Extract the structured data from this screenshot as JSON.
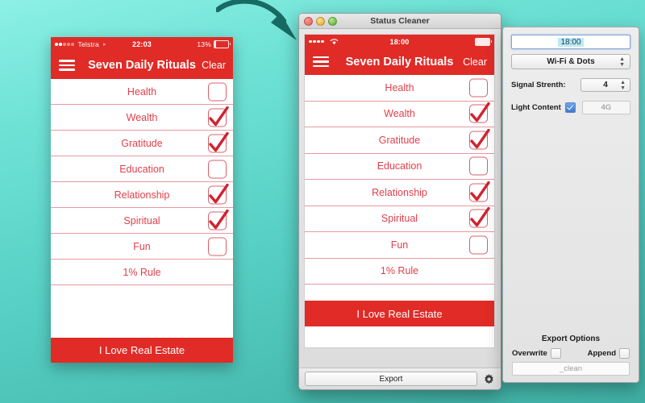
{
  "phone": {
    "statusbar": {
      "carrier": "Telstra",
      "time": "22:03",
      "battery_pct": "13%",
      "battery_level": 13,
      "signal_dots_filled": 2,
      "signal_dots_total": 5,
      "caret": "▸"
    },
    "navbar": {
      "title": "Seven Daily Rituals",
      "clear_label": "Clear",
      "menu_icon": "hamburger-icon"
    },
    "rows": [
      {
        "label": "Health",
        "checkbox": true,
        "checked": false
      },
      {
        "label": "Wealth",
        "checkbox": true,
        "checked": true
      },
      {
        "label": "Gratitude",
        "checkbox": true,
        "checked": true
      },
      {
        "label": "Education",
        "checkbox": true,
        "checked": false
      },
      {
        "label": "Relationship",
        "checkbox": true,
        "checked": true
      },
      {
        "label": "Spiritual",
        "checkbox": true,
        "checked": true
      },
      {
        "label": "Fun",
        "checkbox": true,
        "checked": false
      },
      {
        "label": "1% Rule",
        "checkbox": false,
        "checked": false
      }
    ],
    "footer_label": "I Love Real Estate"
  },
  "mac_window": {
    "title": "Status Cleaner",
    "traffic_lights": [
      "close-button",
      "minimize-button",
      "zoom-button"
    ],
    "export_button_label": "Export",
    "gear_icon": "gear-icon",
    "preview": {
      "statusbar": {
        "time": "18:00",
        "signal_dots_filled": 4,
        "signal_dots_total": 4,
        "wifi_icon": "wifi-icon",
        "battery_full": true
      },
      "navbar": {
        "title": "Seven Daily Rituals",
        "clear_label": "Clear",
        "menu_icon": "hamburger-icon"
      },
      "rows": [
        {
          "label": "Health",
          "checkbox": true,
          "checked": false
        },
        {
          "label": "Wealth",
          "checkbox": true,
          "checked": true
        },
        {
          "label": "Gratitude",
          "checkbox": true,
          "checked": true
        },
        {
          "label": "Education",
          "checkbox": true,
          "checked": false
        },
        {
          "label": "Relationship",
          "checkbox": true,
          "checked": true
        },
        {
          "label": "Spiritual",
          "checkbox": true,
          "checked": true
        },
        {
          "label": "Fun",
          "checkbox": true,
          "checked": false
        },
        {
          "label": "1% Rule",
          "checkbox": false,
          "checked": false
        }
      ],
      "footer_label": "I Love Real Estate"
    }
  },
  "settings_panel": {
    "time_field_value": "18:00",
    "style_popup_value": "Wi-Fi & Dots",
    "signal_strength_label": "Signal Strenth:",
    "signal_strength_value": "4",
    "light_content_label": "Light Content",
    "light_content_checked": true,
    "carrier_field_value": "4G",
    "export_options_title": "Export Options",
    "overwrite_label": "Overwrite",
    "overwrite_checked": false,
    "append_label": "Append",
    "append_checked": false,
    "suffix_field_value": "_clean"
  },
  "colors": {
    "brand_red": "#E02B27",
    "row_text_red": "#E0404B",
    "row_divider": "#E79AA0",
    "bg_top": "#8DF0E6",
    "bg_bottom": "#3FAFA4",
    "arrow": "#186B64",
    "accent_blue": "#3C78CC"
  },
  "arrow": {
    "icon": "curved-arrow-icon",
    "direction": "left-to-right"
  }
}
